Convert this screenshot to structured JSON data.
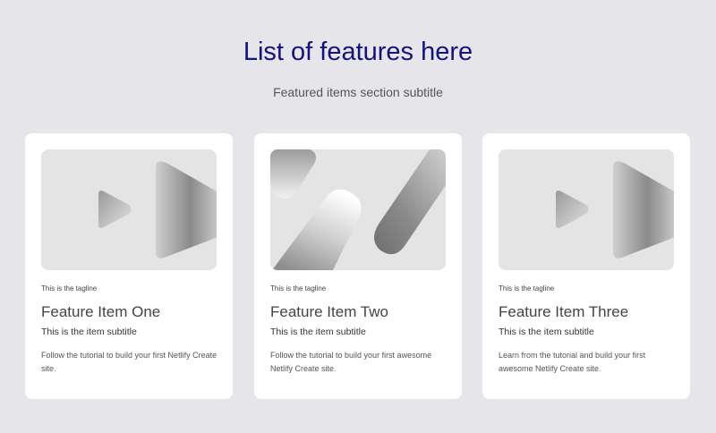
{
  "section": {
    "title": "List of features here",
    "subtitle": "Featured items section subtitle"
  },
  "cards": [
    {
      "tagline": "This is the tagline",
      "title": "Feature Item One",
      "subtitle": "This is the item subtitle",
      "text": "Follow the tutorial to build your first Netlify Create site.",
      "image_icon": "play-shapes-icon"
    },
    {
      "tagline": "This is the tagline",
      "title": "Feature Item Two",
      "subtitle": "This is the item subtitle",
      "text": "Follow the tutorial to build your first awesome Netlify Create site.",
      "image_icon": "abstract-pills-icon"
    },
    {
      "tagline": "This is the tagline",
      "title": "Feature Item Three",
      "subtitle": "This is the item subtitle",
      "text": "Learn from the tutorial and build your first awesome Netlify Create site.",
      "image_icon": "play-shapes-icon"
    }
  ],
  "colors": {
    "page_background": "#e6e6ea",
    "title": "#13137a",
    "card_background": "#ffffff",
    "media_background": "#e4e4e4"
  }
}
